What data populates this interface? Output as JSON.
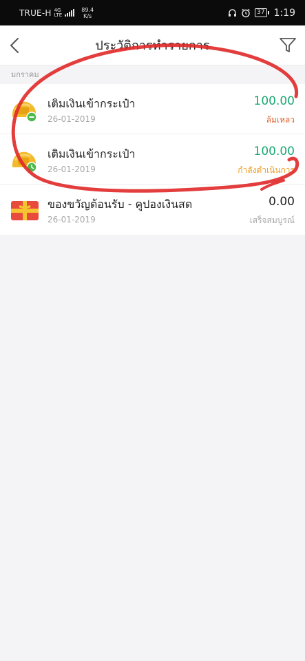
{
  "status_bar": {
    "carrier": "TRUE-H",
    "network_type_top": "4G",
    "network_type_bottom": "LTE",
    "speed_value": "89.4",
    "speed_unit": "K/s",
    "battery": "37",
    "time": "1:19"
  },
  "header": {
    "title": "ประวัติการทำรายการ",
    "back_icon": "chevron-left-icon",
    "filter_icon": "funnel-icon"
  },
  "section": {
    "month_label": "มกราคม"
  },
  "transactions": [
    {
      "title": "เติมเงินเข้ากระเป๋า",
      "date": "26-01-2019",
      "amount": "100.00",
      "amount_color": "#18a873",
      "status": "ล้มเหลว",
      "status_color": "#e0622e",
      "icon": "wallet-failed-icon"
    },
    {
      "title": "เติมเงินเข้ากระเป๋า",
      "date": "26-01-2019",
      "amount": "100.00",
      "amount_color": "#18a873",
      "status": "กำลังดำเนินการ",
      "status_color": "#ee9a1c",
      "icon": "wallet-pending-icon"
    },
    {
      "title": "ของขวัญต้อนรับ - คูปองเงินสด",
      "date": "26-01-2019",
      "amount": "0.00",
      "amount_color": "#222222",
      "status": "เสร็จสมบูรณ์",
      "status_color": "#a6a6a6",
      "icon": "gift-icon"
    }
  ],
  "annotation_color": "#e02828"
}
